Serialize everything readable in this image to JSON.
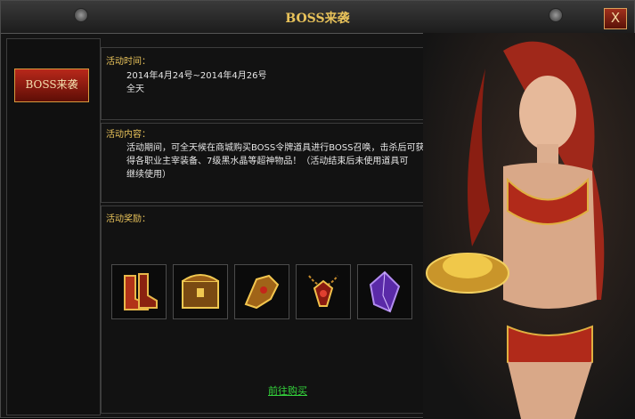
{
  "window": {
    "title": "BOSS来袭",
    "close_label": "X"
  },
  "sidebar": {
    "tab_label": "BOSS来袭"
  },
  "activity": {
    "time_label": "活动时间：",
    "time_range": "2014年4月24号~2014年4月26号",
    "time_detail": "全天",
    "content_label": "活动内容：",
    "content_line1": "活动期间，可全天候在商城购买BOSS令牌道具进行BOSS召唤，击杀后可获",
    "content_line2": "得各职业主宰装备、7级黑水晶等超神物品！（活动结束后未使用道具可",
    "content_line3": "继续使用）",
    "reward_label": "活动奖励："
  },
  "rewards": [
    {
      "icon": "boots-icon"
    },
    {
      "icon": "treasure-chest-icon"
    },
    {
      "icon": "gauntlet-icon"
    },
    {
      "icon": "amulet-icon"
    },
    {
      "icon": "purple-crystal-icon"
    }
  ],
  "buy_link": "前往购买",
  "colors": {
    "gold": "#e8c25a",
    "link": "#34d53c",
    "accent_red": "#a0301c"
  }
}
